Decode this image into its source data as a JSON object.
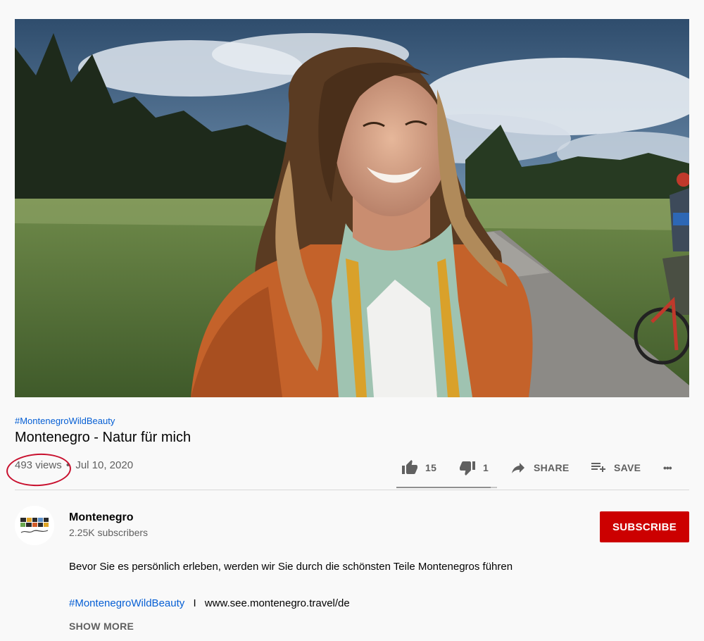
{
  "video": {
    "hashtag": "#MontenegroWildBeauty",
    "title": "Montenegro - Natur für mich",
    "views": "493 views",
    "separator": "•",
    "date": "Jul 10, 2020"
  },
  "actions": {
    "like_count": "15",
    "dislike_count": "1",
    "share_label": "SHARE",
    "save_label": "SAVE",
    "more_label": "•••",
    "like_ratio": 0.9375
  },
  "channel": {
    "name": "Montenegro",
    "subscribers": "2.25K subscribers",
    "subscribe_label": "SUBSCRIBE"
  },
  "description": {
    "text": "Bevor Sie es persönlich erleben, werden wir Sie durch die schönsten Teile Montenegros führen",
    "hashtag": "#MontenegroWildBeauty",
    "separator": "I",
    "url": "www.see.montenegro.travel/de",
    "show_more_label": "SHOW MORE"
  },
  "icons": {
    "like": "thumbs-up-icon",
    "dislike": "thumbs-down-icon",
    "share": "share-arrow-icon",
    "save": "playlist-add-icon",
    "more": "more-horizontal-icon"
  },
  "colors": {
    "link": "#065fd4",
    "subscribe": "#cc0000",
    "annotation": "#c8102e",
    "secondary_text": "#606060"
  }
}
